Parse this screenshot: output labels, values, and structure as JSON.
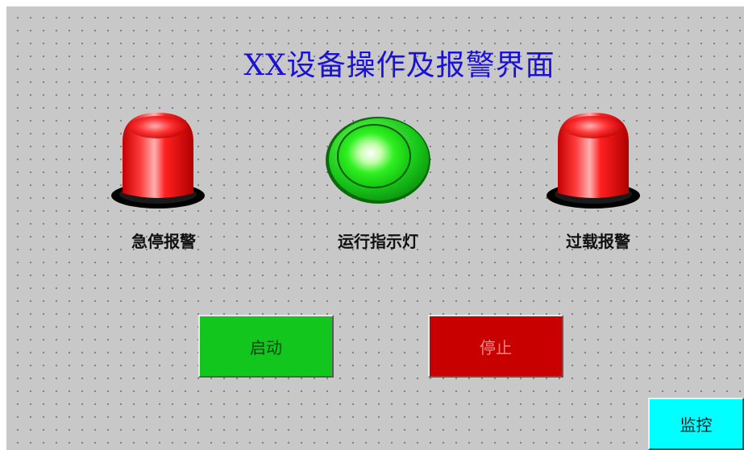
{
  "title": "XX设备操作及报警界面",
  "indicators": [
    {
      "label": "急停报警",
      "type": "alarm-beacon",
      "color": "#ff0000"
    },
    {
      "label": "运行指示灯",
      "type": "run-lamp",
      "color": "#22ee22"
    },
    {
      "label": "过载报警",
      "type": "alarm-beacon",
      "color": "#ff0000"
    }
  ],
  "buttons": {
    "start": {
      "label": "启动",
      "color": "#12c61e"
    },
    "stop": {
      "label": "停止",
      "color": "#c80000"
    },
    "monitor": {
      "label": "监控",
      "color": "#00ffff"
    }
  },
  "colors": {
    "background": "#c8c8c8",
    "title": "#1a10d8"
  }
}
